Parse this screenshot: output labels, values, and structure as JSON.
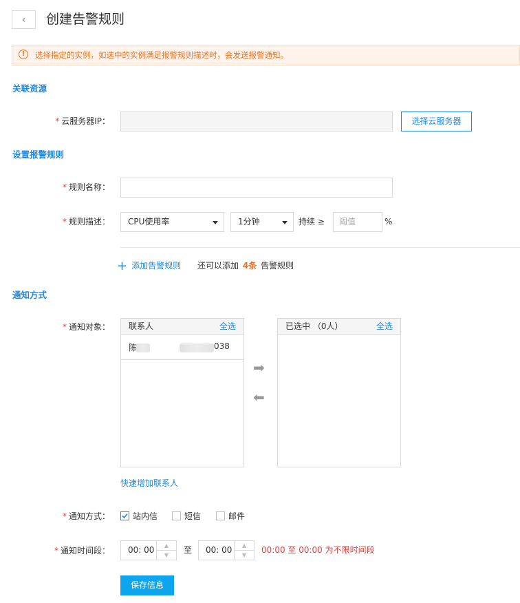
{
  "header": {
    "back_icon": "‹",
    "title": "创建告警规则"
  },
  "alert": {
    "icon": "!",
    "text": "选择指定的实例，如选中的实例满足报警规则描述时，会发送报警通知。",
    "color": "#f0701e"
  },
  "sections": {
    "resource": "关联资源",
    "rules": "设置报警规则",
    "notify": "通知方式"
  },
  "resource": {
    "required": "*",
    "label": "云服务器IP：",
    "value": "",
    "select_button": "选择云服务器"
  },
  "rule_name": {
    "required": "*",
    "label": "规则名称：",
    "value": ""
  },
  "rule_desc": {
    "required": "*",
    "label": "规则描述：",
    "metric": "CPU使用率",
    "duration": "1分钟",
    "operator": "持续 ≥",
    "threshold_placeholder": "阈值",
    "unit": "%"
  },
  "add_rule": {
    "icon": "+",
    "label": "添加告警规则",
    "hint_prefix": "还可以添加",
    "remaining": "4条",
    "hint_suffix": "告警规则"
  },
  "notify_target": {
    "required": "*",
    "label": "通知对象：",
    "left_header": "联系人",
    "left_select_all": "全选",
    "contacts": [
      {
        "prefix": "陈",
        "suffix": "038"
      }
    ],
    "right_header": "已选中 （0人）",
    "right_select_all": "全选",
    "move_right_icon": "➡",
    "move_left_icon": "⬅",
    "quick_add": "快速增加联系人"
  },
  "notify_method": {
    "required": "*",
    "label": "通知方式：",
    "options": [
      {
        "label": "站内信",
        "checked": true
      },
      {
        "label": "短信",
        "checked": false
      },
      {
        "label": "邮件",
        "checked": false
      }
    ]
  },
  "notify_time": {
    "required": "*",
    "label": "通知时间段：",
    "start": "00: 00",
    "to": "至",
    "end": "00: 00",
    "up_icon": "▲",
    "down_icon": "▼",
    "hint": "00:00 至 00:00 为不限时间段",
    "hint_color": "#e0403c"
  },
  "save_button": "保存信息",
  "colors": {
    "accent": "#1e88e5",
    "primary_button": "#0ea5ef",
    "warning": "#f0701e",
    "remaining": "#f0701e"
  }
}
